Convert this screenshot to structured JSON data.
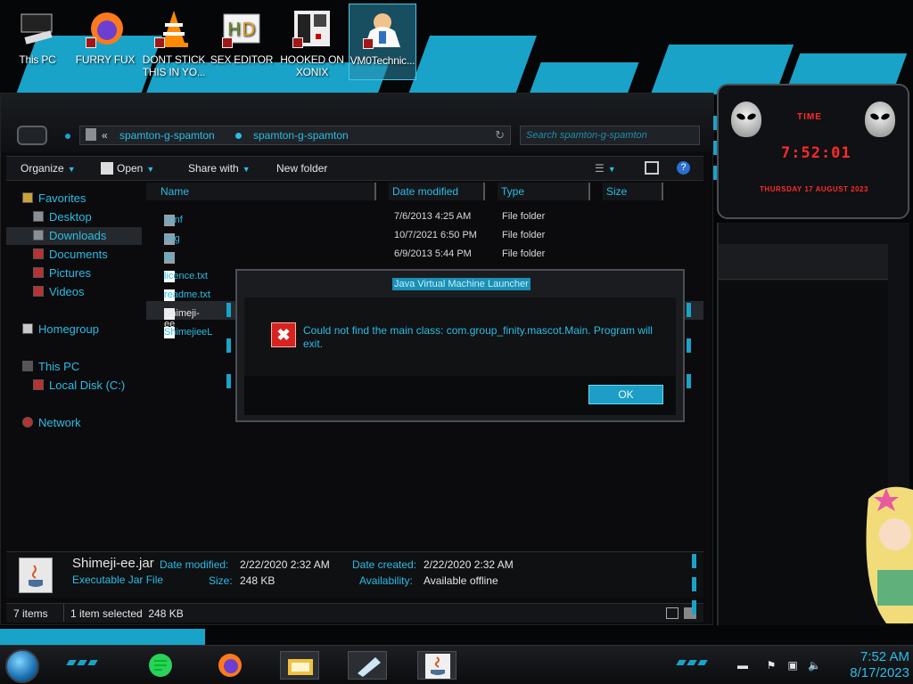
{
  "desktop": {
    "icons": [
      {
        "label": "This PC"
      },
      {
        "label": "FURRY FUX"
      },
      {
        "label": "DONT STICK THIS IN YO..."
      },
      {
        "label": "SEX EDITOR"
      },
      {
        "label": "HOOKED ON XONIX"
      },
      {
        "label": "VM0Technic..."
      }
    ]
  },
  "explorer": {
    "address": {
      "chevron": "«",
      "crumb1": "spamton-g-spamton",
      "crumb2": "spamton-g-spamton"
    },
    "search_placeholder": "Search spamton-g-spamton",
    "toolbar": {
      "organize": "Organize",
      "open": "Open",
      "share_with": "Share with",
      "new_folder": "New folder"
    },
    "nav": {
      "favorites": "Favorites",
      "desktop": "Desktop",
      "downloads": "Downloads",
      "documents": "Documents",
      "pictures": "Pictures",
      "videos": "Videos",
      "homegroup": "Homegroup",
      "this_pc": "This PC",
      "local_disk": "Local Disk (C:)",
      "network": "Network"
    },
    "columns": {
      "name": "Name",
      "date_modified": "Date modified",
      "type": "Type",
      "size": "Size"
    },
    "files": [
      {
        "name": "conf",
        "date": "7/6/2013 4:25 AM",
        "type": "File folder"
      },
      {
        "name": "img",
        "date": "10/7/2021 6:50 PM",
        "type": "File folder"
      },
      {
        "name": "lib",
        "date": "6/9/2013 5:44 PM",
        "type": "File folder"
      },
      {
        "name": "licence.txt",
        "date": "",
        "type": ""
      },
      {
        "name": "readme.txt",
        "date": "",
        "type": ""
      },
      {
        "name": "Shimeji-ee",
        "date": "",
        "type": ""
      },
      {
        "name": "ShimejieeL",
        "date": "",
        "type": ""
      }
    ],
    "details": {
      "filename": "Shimeji-ee.jar",
      "filetype": "Executable Jar File",
      "date_modified_label": "Date modified:",
      "date_modified": "2/22/2020 2:32 AM",
      "size_label": "Size:",
      "size": "248 KB",
      "date_created_label": "Date created:",
      "date_created": "2/22/2020 2:32 AM",
      "availability_label": "Availability:",
      "availability": "Available offline"
    },
    "status": {
      "items": "7 items",
      "selected": "1 item selected  248 KB"
    }
  },
  "dialog": {
    "title": "Java Virtual Machine Launcher",
    "message": "Could not find the main class: com.group_finity.mascot.Main. Program will exit.",
    "ok": "OK"
  },
  "gadget": {
    "label": "TIME",
    "time": "7:52:01",
    "date": "THURSDAY 17 AUGUST 2023"
  },
  "taskbar": {
    "time": "7:52 AM",
    "date": "8/17/2023"
  },
  "colors": {
    "accent": "#2bbde6",
    "dialog_title": "#1d8fb5",
    "error_red": "#d7231f",
    "gadget_red": "#ff2a2a"
  }
}
